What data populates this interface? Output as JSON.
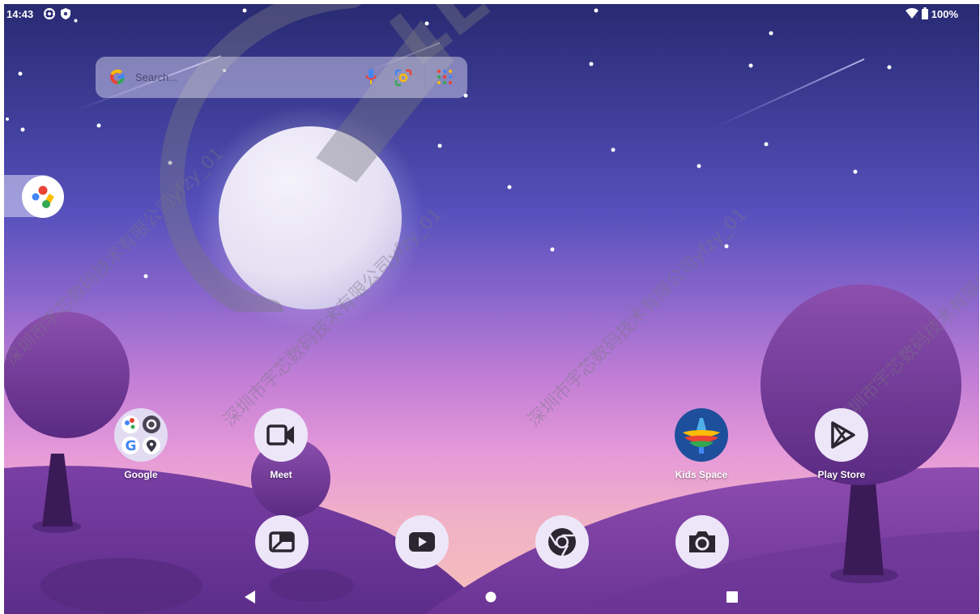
{
  "status_bar": {
    "time": "14:43",
    "battery": "100%",
    "icons": [
      "settings-gear-icon",
      "shield-icon",
      "dot-icon",
      "wifi-icon",
      "battery-icon"
    ]
  },
  "search_widget": {
    "placeholder": "Search...",
    "icons": [
      "google-g-icon",
      "mic-icon",
      "lens-icon",
      "apps-grid-icon"
    ]
  },
  "side_app": {
    "icon": "assistant-icon"
  },
  "home_apps": [
    {
      "label": "Google",
      "icon": "google-folder-icon"
    },
    {
      "label": "Meet",
      "icon": "video-camera-icon"
    },
    {
      "label": "Kids Space",
      "icon": "kids-space-icon"
    },
    {
      "label": "Play Store",
      "icon": "play-store-icon"
    }
  ],
  "dock_apps": [
    {
      "icon": "gallery-icon"
    },
    {
      "icon": "youtube-play-icon"
    },
    {
      "icon": "chrome-icon"
    },
    {
      "icon": "camera-icon"
    }
  ],
  "nav_bar": {
    "buttons": [
      "back-icon",
      "home-icon",
      "recents-icon"
    ]
  },
  "watermark": {
    "text": "深圳市宇芯数码技术有限公司yfzy_01",
    "logo": "Allwinner"
  },
  "colors": {
    "sky_top": "#282a72",
    "sky_bottom": "#f7c0b8",
    "icon_bg": "#ece6f8",
    "icon_glyph": "#2b2730",
    "hill": "#7a3fa4"
  }
}
